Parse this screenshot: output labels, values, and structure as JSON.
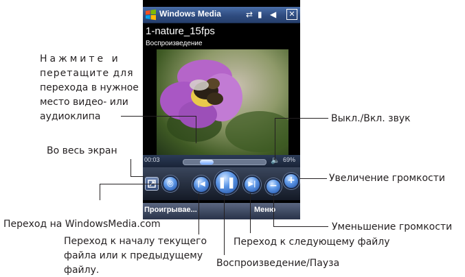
{
  "device": {
    "app_title": "Windows Media",
    "clip_title": "1-nature_15fps",
    "clip_status": "Воспроизведение",
    "elapsed_time": "00:03",
    "volume_level": "69%",
    "softkey_left": "Проигрывае...",
    "softkey_right": "Меню"
  },
  "callouts": {
    "drag_seek": [
      "Нажмите и",
      "перетащите для",
      "перехода в нужное",
      "место видео- или",
      "аудиоклипа"
    ],
    "fullscreen": "Во весь экран",
    "mute": "Выкл./Вкл. звук",
    "volume_up": "Увеличение громкости",
    "windowsmedia": "Переход на WindowsMedia.com",
    "volume_down": "Уменьшение громкости",
    "previous": [
      "Переход к началу текущего",
      "файла или к предыдущему",
      "файлу."
    ],
    "next": "Переход к следующему файлу",
    "play_pause": "Воспроизведение/Пауза"
  }
}
